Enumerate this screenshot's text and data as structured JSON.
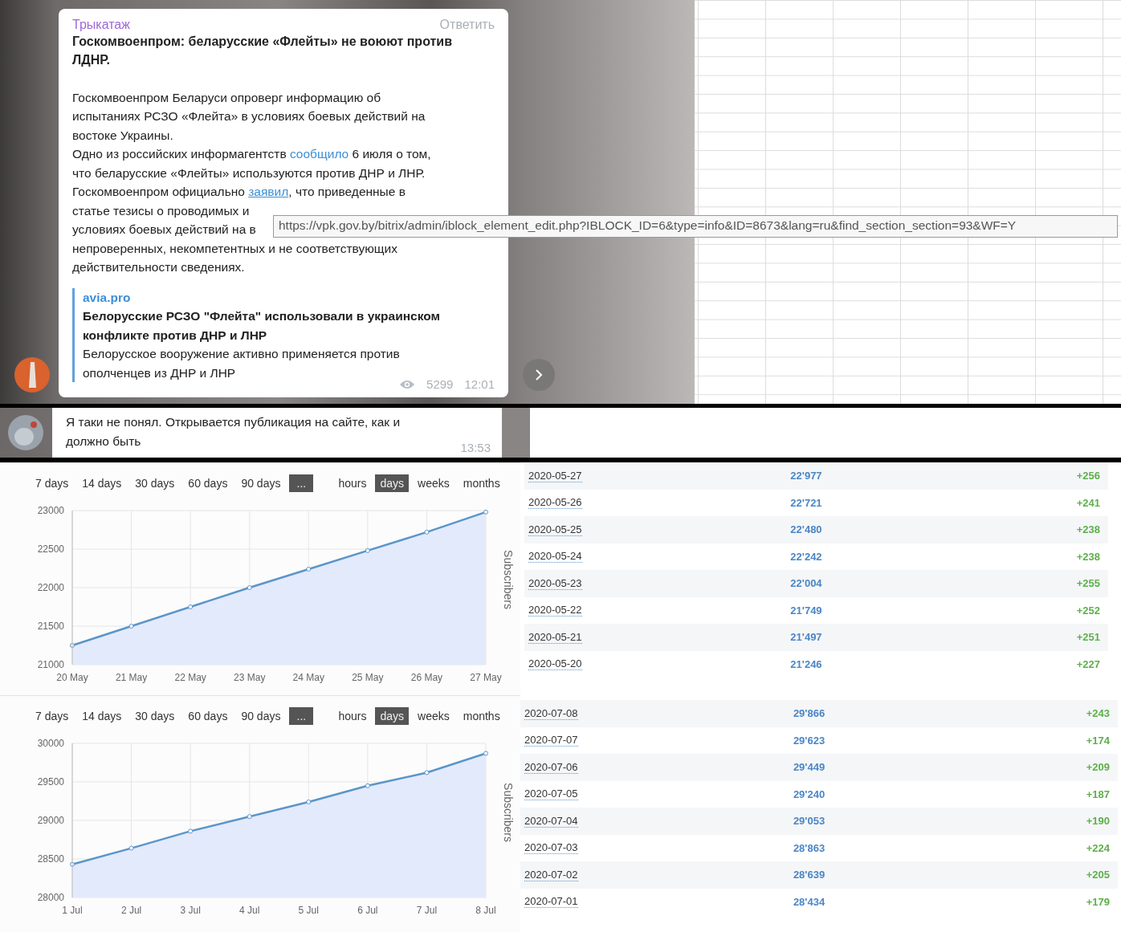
{
  "message": {
    "sender": "Трыкатаж",
    "reply": "Ответить",
    "title": "Госкомвоенпром: беларусские «Флейты» не воюют против\nЛДНР.",
    "body": [
      [
        {
          "kind": "text",
          "text": "Госкомвоенпром Беларуси опроверг информацию об\nиспытаниях РСЗО «Флейта» в условиях боевых действий на\nвостоке Украины.\nОдно из российских информагентств "
        },
        {
          "kind": "link",
          "text": "сообщило",
          "hovered": false
        },
        {
          "kind": "text",
          "text": " 6 июля о том,\nчто беларусские «Флейты» используются против ДНР и ЛНР.\nГоскомвоенпром официально "
        },
        {
          "kind": "link",
          "text": "заявил",
          "hovered": true
        },
        {
          "kind": "text",
          "text": ", что приведенные в"
        }
      ],
      [
        {
          "kind": "text",
          "text": "статье тезисы о проводимых и"
        }
      ],
      [
        {
          "kind": "text",
          "text": "условиях боевых действий на в"
        }
      ],
      [
        {
          "kind": "text",
          "text": "непроверенных, некомпетентных и не соответствующих\nдействительности сведениях."
        }
      ]
    ],
    "preview": {
      "site": "avia.pro",
      "title": "Белорусские РСЗО \"Флейта\" использовали в украинском\nконфликте против ДНР и ЛНР",
      "description": "Белорусское вооружение активно применяется против\nополченцев из ДНР и ЛНР"
    },
    "views": "5299",
    "time": "12:01"
  },
  "tooltip": "https://vpk.gov.by/bitrix/admin/iblock_element_edit.php?IBLOCK_ID=6&type=info&ID=8673&lang=ru&find_section_section=93&WF=Y",
  "reply_message": {
    "text": "Я таки не понял. Открывается публикация на сайте, как и\nдолжно быть",
    "time": "13:53"
  },
  "stats_panels": [
    {
      "ranges": [
        {
          "label": "7 days",
          "selected": false
        },
        {
          "label": "14 days",
          "selected": false
        },
        {
          "label": "30 days",
          "selected": false
        },
        {
          "label": "60 days",
          "selected": false
        },
        {
          "label": "90 days",
          "selected": false
        }
      ],
      "more": "...",
      "units": [
        {
          "label": "hours",
          "selected": false
        },
        {
          "label": "days",
          "selected": true
        },
        {
          "label": "weeks",
          "selected": false
        },
        {
          "label": "months",
          "selected": false
        }
      ],
      "chart_data": {
        "type": "area",
        "ylabel": "Subscribers",
        "categories": [
          "20 May",
          "21 May",
          "22 May",
          "23 May",
          "24 May",
          "25 May",
          "26 May",
          "27 May"
        ],
        "series": [
          {
            "color": "#5b95c9",
            "values": [
              21250,
              21500,
              21750,
              22000,
              22240,
              22480,
              22720,
              22980
            ]
          }
        ],
        "ylim": [
          21000,
          23000
        ],
        "grid": true,
        "yticks": [
          21000,
          21500,
          22000,
          22500,
          23000
        ]
      },
      "rows": [
        {
          "date": "2020-05-27",
          "total": "22'977",
          "change": "+256"
        },
        {
          "date": "2020-05-26",
          "total": "22'721",
          "change": "+241"
        },
        {
          "date": "2020-05-25",
          "total": "22'480",
          "change": "+238"
        },
        {
          "date": "2020-05-24",
          "total": "22'242",
          "change": "+238"
        },
        {
          "date": "2020-05-23",
          "total": "22'004",
          "change": "+255"
        },
        {
          "date": "2020-05-22",
          "total": "21'749",
          "change": "+252"
        },
        {
          "date": "2020-05-21",
          "total": "21'497",
          "change": "+251"
        },
        {
          "date": "2020-05-20",
          "total": "21'246",
          "change": "+227"
        }
      ]
    },
    {
      "ranges": [
        {
          "label": "7 days",
          "selected": false
        },
        {
          "label": "14 days",
          "selected": false
        },
        {
          "label": "30 days",
          "selected": false
        },
        {
          "label": "60 days",
          "selected": false
        },
        {
          "label": "90 days",
          "selected": false
        }
      ],
      "more": "...",
      "units": [
        {
          "label": "hours",
          "selected": false
        },
        {
          "label": "days",
          "selected": true
        },
        {
          "label": "weeks",
          "selected": false
        },
        {
          "label": "months",
          "selected": false
        }
      ],
      "chart_data": {
        "type": "area",
        "ylabel": "Subscribers",
        "categories": [
          "1 Jul",
          "2 Jul",
          "3 Jul",
          "4 Jul",
          "5 Jul",
          "6 Jul",
          "7 Jul",
          "8 Jul"
        ],
        "series": [
          {
            "color": "#5b95c9",
            "values": [
              28430,
              28640,
              28860,
              29050,
              29240,
              29450,
              29620,
              29870
            ]
          }
        ],
        "ylim": [
          28000,
          30000
        ],
        "grid": true,
        "yticks": [
          28000,
          28500,
          29000,
          29500,
          30000
        ]
      },
      "rows": [
        {
          "date": "2020-07-08",
          "total": "29'866",
          "change": "+243"
        },
        {
          "date": "2020-07-07",
          "total": "29'623",
          "change": "+174"
        },
        {
          "date": "2020-07-06",
          "total": "29'449",
          "change": "+209"
        },
        {
          "date": "2020-07-05",
          "total": "29'240",
          "change": "+187"
        },
        {
          "date": "2020-07-04",
          "total": "29'053",
          "change": "+190"
        },
        {
          "date": "2020-07-03",
          "total": "28'863",
          "change": "+224"
        },
        {
          "date": "2020-07-02",
          "total": "28'639",
          "change": "+205"
        },
        {
          "date": "2020-07-01",
          "total": "28'434",
          "change": "+179"
        }
      ]
    }
  ]
}
